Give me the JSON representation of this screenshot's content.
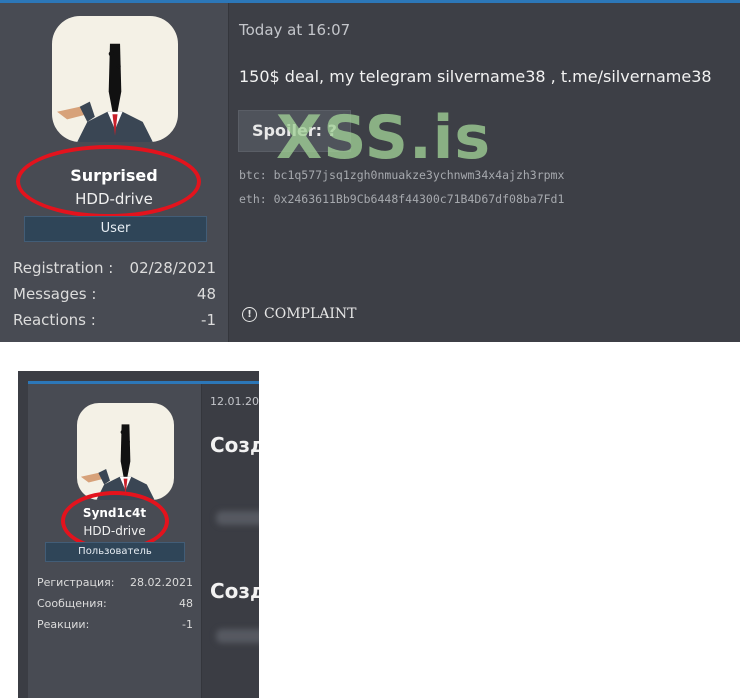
{
  "top_post": {
    "user": {
      "name": "Surprised",
      "title": "HDD-drive",
      "banner": "User",
      "avatar_icon": "suited-man-avatar-icon",
      "stats": [
        {
          "label": "Registration :",
          "value": "02/28/2021"
        },
        {
          "label": "Messages :",
          "value": "48"
        },
        {
          "label": "Reactions :",
          "value": "-1"
        }
      ]
    },
    "date": "Today at 16:07",
    "message": "150$ deal, my telegram silvername38 , t.me/silvername38",
    "spoiler_label": "Spoiler: ?",
    "watermark": "XSS.is",
    "btc_line": "btc: bc1q577jsq1zgh0nmuakze3ychnwm34x4ajzh3rpmx",
    "eth_line": "eth: 0x2463611Bb9Cb6448f44300c71B4D67df08ba7Fd1",
    "complaint_label": "COMPLAINT",
    "complaint_icon": "exclamation-circle-icon"
  },
  "bottom_post": {
    "user": {
      "name": "Synd1c4t",
      "title": "HDD-drive",
      "banner": "Пользователь",
      "avatar_icon": "suited-man-avatar-icon",
      "stats": [
        {
          "label": "Регистрация:",
          "value": "28.02.2021"
        },
        {
          "label": "Сообщения:",
          "value": "48"
        },
        {
          "label": "Реакции:",
          "value": "-1"
        }
      ]
    },
    "date": "12.01.20",
    "heading_1": "Созд",
    "heading_2": "Созд"
  },
  "colors": {
    "accent_blue": "#2c77b8",
    "highlight_ring": "#e3131d",
    "watermark": "#a0d096"
  }
}
